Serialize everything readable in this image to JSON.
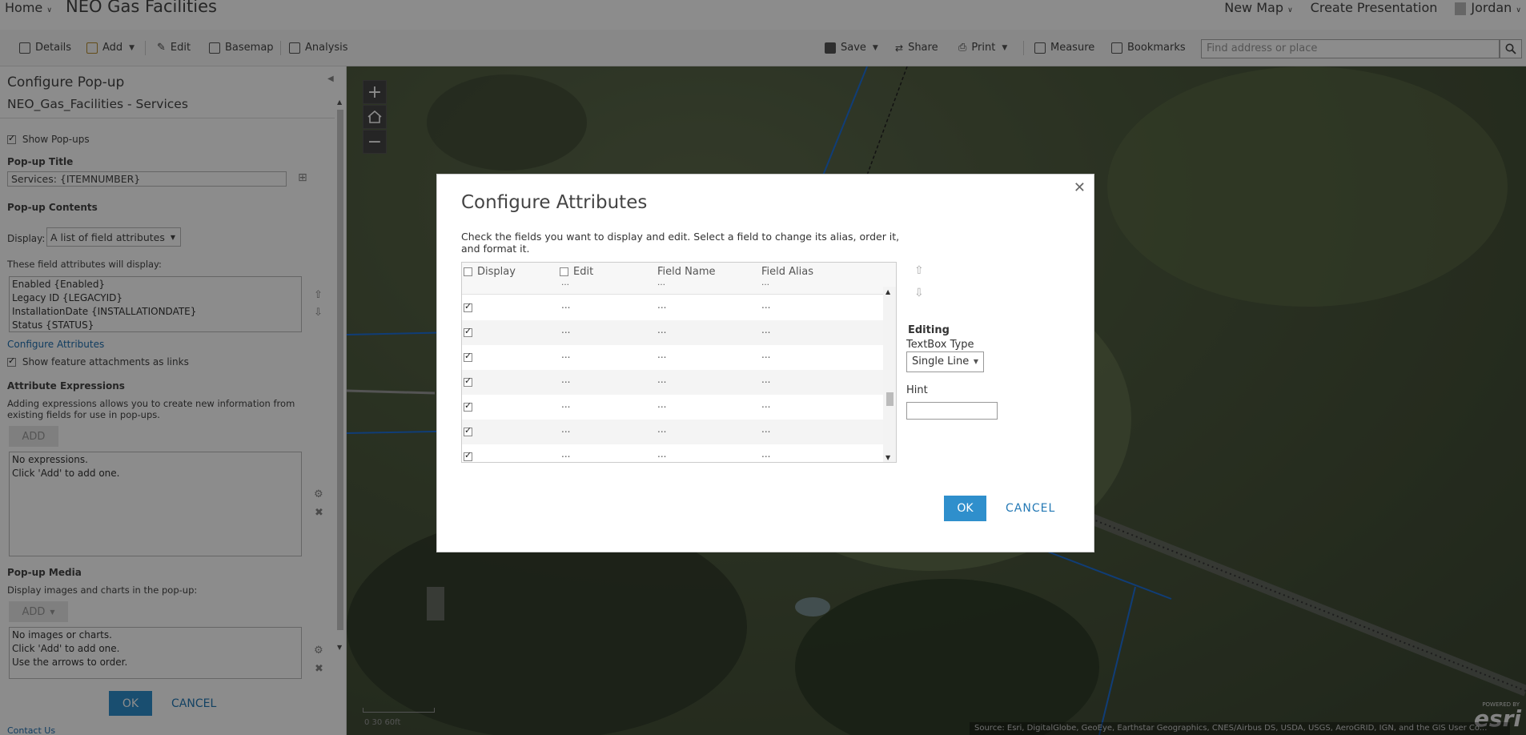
{
  "topbar": {
    "home": "Home",
    "map_title": "NEO Gas Facilities",
    "new_map": "New Map",
    "create_presentation": "Create Presentation",
    "user": "Jordan"
  },
  "toolbar": {
    "details": "Details",
    "add": "Add",
    "edit": "Edit",
    "basemap": "Basemap",
    "analysis": "Analysis",
    "save": "Save",
    "share": "Share",
    "print": "Print",
    "measure": "Measure",
    "bookmarks": "Bookmarks",
    "search_placeholder": "Find address or place"
  },
  "left_panel": {
    "heading": "Configure Pop-up",
    "layer_name": "NEO_Gas_Facilities - Services",
    "show_popups": "Show Pop-ups",
    "popup_title_label": "Pop-up Title",
    "popup_title_value": "Services: {ITEMNUMBER}",
    "popup_contents_label": "Pop-up Contents",
    "display_label": "Display:",
    "display_value": "A list of field attributes",
    "fields_label": "These field attributes will display:",
    "field_list": [
      "Enabled {Enabled}",
      "Legacy ID {LEGACYID}",
      "InstallationDate {INSTALLATIONDATE}",
      "Status {STATUS}"
    ],
    "configure_attributes_link": "Configure Attributes",
    "show_attachments": "Show feature attachments as links",
    "attr_expr_label": "Attribute Expressions",
    "attr_expr_desc": "Adding expressions allows you to create new information from existing fields for use in pop-ups.",
    "add_button": "ADD",
    "expr_box": [
      "No expressions.",
      "Click 'Add' to add one."
    ],
    "media_label": "Pop-up Media",
    "media_desc": "Display images and charts in the pop-up:",
    "media_add_button": "ADD",
    "media_box": [
      "No images or charts.",
      "Click 'Add' to add one.",
      "Use the arrows to order."
    ],
    "ok": "OK",
    "cancel": "CANCEL",
    "contact_us": "Contact Us"
  },
  "map": {
    "attribution": "Source: Esri, DigitalGlobe, GeoEye, Earthstar Geographics, CNES/Airbus DS, USDA, USGS, AeroGRID, IGN, and the GIS User Co...",
    "scale_label": "0      30      60ft",
    "powered_by": "POWERED BY",
    "esri": "esri"
  },
  "dialog": {
    "title": "Configure Attributes",
    "description": "Check the fields you want to display and edit. Select a field to change its alias, order it, and format it.",
    "columns": {
      "display": "Display",
      "edit": "Edit",
      "field_name": "Field Name",
      "field_alias": "Field Alias"
    },
    "rows": [
      {
        "display": true,
        "edit": "...",
        "name": "...",
        "alias": "..."
      },
      {
        "display": true,
        "edit": "...",
        "name": "...",
        "alias": "..."
      },
      {
        "display": true,
        "edit": "...",
        "name": "...",
        "alias": "..."
      },
      {
        "display": true,
        "edit": "...",
        "name": "...",
        "alias": "..."
      },
      {
        "display": true,
        "edit": "...",
        "name": "...",
        "alias": "..."
      },
      {
        "display": true,
        "edit": "...",
        "name": "...",
        "alias": "..."
      },
      {
        "display": true,
        "edit": "...",
        "name": "...",
        "alias": "..."
      }
    ],
    "editing_label": "Editing",
    "textbox_type_label": "TextBox Type",
    "textbox_type_value": "Single Line",
    "hint_label": "Hint",
    "hint_value": "",
    "ok": "OK",
    "cancel": "CANCEL"
  }
}
